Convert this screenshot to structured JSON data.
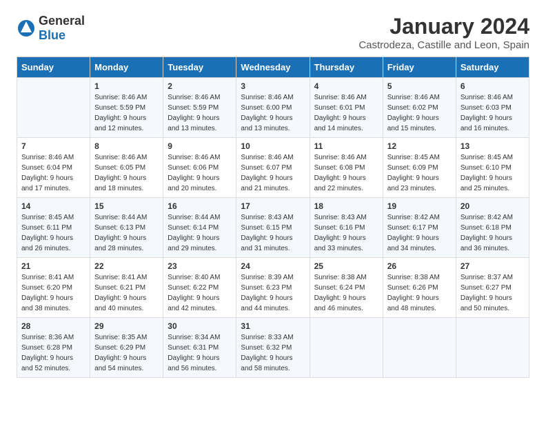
{
  "logo": {
    "general": "General",
    "blue": "Blue"
  },
  "title": "January 2024",
  "location": "Castrodeza, Castille and Leon, Spain",
  "headers": [
    "Sunday",
    "Monday",
    "Tuesday",
    "Wednesday",
    "Thursday",
    "Friday",
    "Saturday"
  ],
  "weeks": [
    [
      {
        "day": "",
        "info": ""
      },
      {
        "day": "1",
        "info": "Sunrise: 8:46 AM\nSunset: 5:59 PM\nDaylight: 9 hours\nand 12 minutes."
      },
      {
        "day": "2",
        "info": "Sunrise: 8:46 AM\nSunset: 5:59 PM\nDaylight: 9 hours\nand 13 minutes."
      },
      {
        "day": "3",
        "info": "Sunrise: 8:46 AM\nSunset: 6:00 PM\nDaylight: 9 hours\nand 13 minutes."
      },
      {
        "day": "4",
        "info": "Sunrise: 8:46 AM\nSunset: 6:01 PM\nDaylight: 9 hours\nand 14 minutes."
      },
      {
        "day": "5",
        "info": "Sunrise: 8:46 AM\nSunset: 6:02 PM\nDaylight: 9 hours\nand 15 minutes."
      },
      {
        "day": "6",
        "info": "Sunrise: 8:46 AM\nSunset: 6:03 PM\nDaylight: 9 hours\nand 16 minutes."
      }
    ],
    [
      {
        "day": "7",
        "info": "Sunrise: 8:46 AM\nSunset: 6:04 PM\nDaylight: 9 hours\nand 17 minutes."
      },
      {
        "day": "8",
        "info": "Sunrise: 8:46 AM\nSunset: 6:05 PM\nDaylight: 9 hours\nand 18 minutes."
      },
      {
        "day": "9",
        "info": "Sunrise: 8:46 AM\nSunset: 6:06 PM\nDaylight: 9 hours\nand 20 minutes."
      },
      {
        "day": "10",
        "info": "Sunrise: 8:46 AM\nSunset: 6:07 PM\nDaylight: 9 hours\nand 21 minutes."
      },
      {
        "day": "11",
        "info": "Sunrise: 8:46 AM\nSunset: 6:08 PM\nDaylight: 9 hours\nand 22 minutes."
      },
      {
        "day": "12",
        "info": "Sunrise: 8:45 AM\nSunset: 6:09 PM\nDaylight: 9 hours\nand 23 minutes."
      },
      {
        "day": "13",
        "info": "Sunrise: 8:45 AM\nSunset: 6:10 PM\nDaylight: 9 hours\nand 25 minutes."
      }
    ],
    [
      {
        "day": "14",
        "info": "Sunrise: 8:45 AM\nSunset: 6:11 PM\nDaylight: 9 hours\nand 26 minutes."
      },
      {
        "day": "15",
        "info": "Sunrise: 8:44 AM\nSunset: 6:13 PM\nDaylight: 9 hours\nand 28 minutes."
      },
      {
        "day": "16",
        "info": "Sunrise: 8:44 AM\nSunset: 6:14 PM\nDaylight: 9 hours\nand 29 minutes."
      },
      {
        "day": "17",
        "info": "Sunrise: 8:43 AM\nSunset: 6:15 PM\nDaylight: 9 hours\nand 31 minutes."
      },
      {
        "day": "18",
        "info": "Sunrise: 8:43 AM\nSunset: 6:16 PM\nDaylight: 9 hours\nand 33 minutes."
      },
      {
        "day": "19",
        "info": "Sunrise: 8:42 AM\nSunset: 6:17 PM\nDaylight: 9 hours\nand 34 minutes."
      },
      {
        "day": "20",
        "info": "Sunrise: 8:42 AM\nSunset: 6:18 PM\nDaylight: 9 hours\nand 36 minutes."
      }
    ],
    [
      {
        "day": "21",
        "info": "Sunrise: 8:41 AM\nSunset: 6:20 PM\nDaylight: 9 hours\nand 38 minutes."
      },
      {
        "day": "22",
        "info": "Sunrise: 8:41 AM\nSunset: 6:21 PM\nDaylight: 9 hours\nand 40 minutes."
      },
      {
        "day": "23",
        "info": "Sunrise: 8:40 AM\nSunset: 6:22 PM\nDaylight: 9 hours\nand 42 minutes."
      },
      {
        "day": "24",
        "info": "Sunrise: 8:39 AM\nSunset: 6:23 PM\nDaylight: 9 hours\nand 44 minutes."
      },
      {
        "day": "25",
        "info": "Sunrise: 8:38 AM\nSunset: 6:24 PM\nDaylight: 9 hours\nand 46 minutes."
      },
      {
        "day": "26",
        "info": "Sunrise: 8:38 AM\nSunset: 6:26 PM\nDaylight: 9 hours\nand 48 minutes."
      },
      {
        "day": "27",
        "info": "Sunrise: 8:37 AM\nSunset: 6:27 PM\nDaylight: 9 hours\nand 50 minutes."
      }
    ],
    [
      {
        "day": "28",
        "info": "Sunrise: 8:36 AM\nSunset: 6:28 PM\nDaylight: 9 hours\nand 52 minutes."
      },
      {
        "day": "29",
        "info": "Sunrise: 8:35 AM\nSunset: 6:29 PM\nDaylight: 9 hours\nand 54 minutes."
      },
      {
        "day": "30",
        "info": "Sunrise: 8:34 AM\nSunset: 6:31 PM\nDaylight: 9 hours\nand 56 minutes."
      },
      {
        "day": "31",
        "info": "Sunrise: 8:33 AM\nSunset: 6:32 PM\nDaylight: 9 hours\nand 58 minutes."
      },
      {
        "day": "",
        "info": ""
      },
      {
        "day": "",
        "info": ""
      },
      {
        "day": "",
        "info": ""
      }
    ]
  ]
}
